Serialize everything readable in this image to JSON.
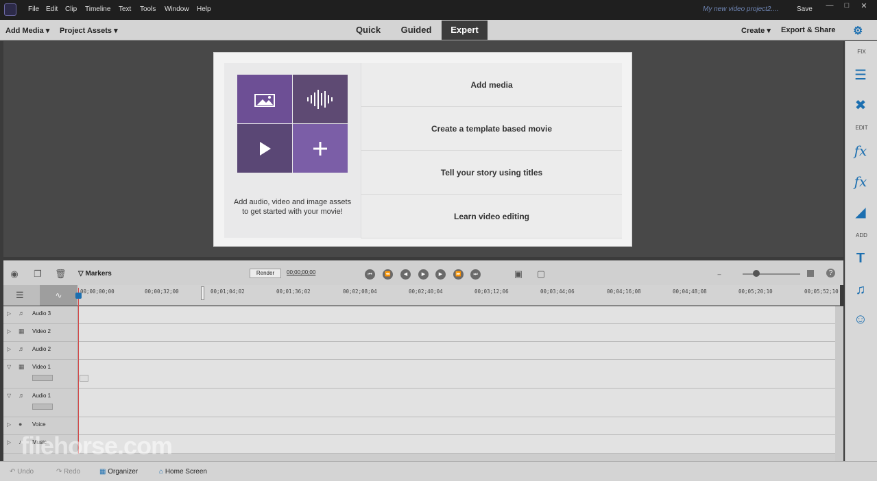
{
  "menubar": {
    "items": [
      "File",
      "Edit",
      "Clip",
      "Timeline",
      "Text",
      "Tools",
      "Window",
      "Help"
    ],
    "project_title": "My new video project2....",
    "save_label": "Save"
  },
  "toolbar": {
    "add_media": "Add Media",
    "project_assets": "Project Assets",
    "modes": [
      "Quick",
      "Guided",
      "Expert"
    ],
    "active_mode": "Expert",
    "create": "Create",
    "export_share": "Export & Share"
  },
  "welcome": {
    "description_line1": "Add audio, video and image assets",
    "description_line2": "to get started with your movie!",
    "options": [
      "Add media",
      "Create a template based movie",
      "Tell your story using titles",
      "Learn video editing"
    ]
  },
  "right_panel": {
    "fix_label": "FIX",
    "edit_label": "EDIT",
    "add_label": "ADD"
  },
  "timeline_toolbar": {
    "markers_label": "Markers",
    "render_label": "Render",
    "timecode": "00;00;00;00"
  },
  "ruler": {
    "ticks": [
      "00;00;00;00",
      "00;00;32;00",
      "00;01;04;02",
      "00;01;36;02",
      "00;02;08;04",
      "00;02;40;04",
      "00;03;12;06",
      "00;03;44;06",
      "00;04;16;08",
      "00;04;48;08",
      "00;05;20;10",
      "00;05;52;10"
    ]
  },
  "tracks": [
    {
      "name": "Audio 3"
    },
    {
      "name": "Video 2"
    },
    {
      "name": "Audio 2"
    },
    {
      "name": "Video 1"
    },
    {
      "name": "Audio 1"
    },
    {
      "name": "Voice"
    },
    {
      "name": "Music"
    }
  ],
  "bottombar": {
    "undo": "Undo",
    "redo": "Redo",
    "organizer": "Organizer",
    "home_screen": "Home Screen"
  },
  "watermark": "filehorse.com",
  "colors": {
    "accent_blue": "#1c6fb0",
    "tile_purple": "#7b5ea7",
    "playhead_red": "#d34a4a"
  }
}
